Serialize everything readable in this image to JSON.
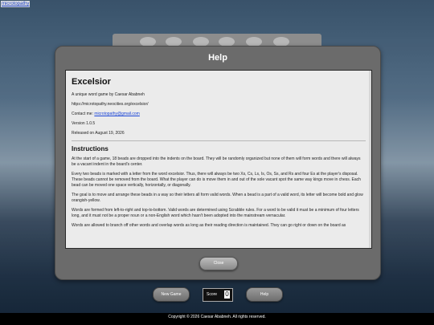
{
  "topbar": {
    "link_label": "microtopathy"
  },
  "modal": {
    "title": "Help",
    "heading": "Excelsior",
    "tagline": "A unique word game by Caesar Ababneh",
    "url": "https://microtopathy.neocities.org/excelsior/",
    "contact_prefix": "Contact me:",
    "contact_link": "microtopathy@gmail.com",
    "version": "Version 1.0.5",
    "released": "Released on August 19, 2026",
    "instructions_heading": "Instructions",
    "paragraphs": [
      "At the start of a game, 18 beads are dropped into the indents on the board. They will be randomly organized but none of them will form words and there will always be a vacant indent in the board's center.",
      "Every two beads is marked with a letter from the word excelsior. Thus, there will always be two Xs, Cs, Ls, Is, Os, Ss, and Rs and four Es at the player's disposal. These beads cannot be removed from the board. What the player can do is move them in and out of the sole vacant spot the same way kings move in chess. Each bead can be moved one space vertically, horizontally, or diagonally.",
      "The goal is to move and arrange these beads in a way so their letters all form valid words. When a bead is a part of a valid word, its letter will become bold and glow orangish-yellow.",
      "Words are formed from left-to-right and top-to-bottom. Valid words are determined using Scrabble rules. For a word to be valid it must be a minimum of four letters long, and it must not be a proper noun or a non-English word which hasn't been adopted into the mainstream vernacular.",
      "Words are allowed to branch off other words and overlap words as long as their reading direction is maintained. They can go right or down on the board as"
    ],
    "close_label": "Close"
  },
  "controls": {
    "new_game_label": "New Game",
    "score_label": "Score",
    "score_value": "0",
    "help_label": "Help"
  },
  "footer": {
    "copyright": "Copyright © 2026 Caesar Ababneh. All rights reserved."
  }
}
